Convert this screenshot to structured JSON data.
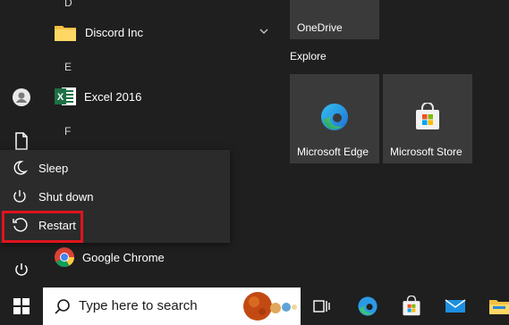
{
  "app_list": {
    "letters": {
      "d": "D",
      "e": "E",
      "f": "F"
    },
    "items": [
      {
        "label": "Discord Inc",
        "icon": "folder-icon"
      },
      {
        "label": "Excel 2016",
        "icon": "excel-icon"
      },
      {
        "label": "Google Chrome",
        "icon": "chrome-icon"
      }
    ]
  },
  "tiles": {
    "onedrive": "OneDrive",
    "section_title": "Explore",
    "edge": "Microsoft Edge",
    "store": "Microsoft Store"
  },
  "power_menu": {
    "sleep": "Sleep",
    "shutdown": "Shut down",
    "restart": "Restart"
  },
  "taskbar": {
    "search_placeholder": "Type here to search"
  },
  "colors": {
    "background": "#1f1f1f",
    "tile": "#3a3a3a",
    "menu": "#2b2b2b",
    "highlight": "#e0141e",
    "folder": "#f3c043",
    "excel": "#1d7044"
  }
}
